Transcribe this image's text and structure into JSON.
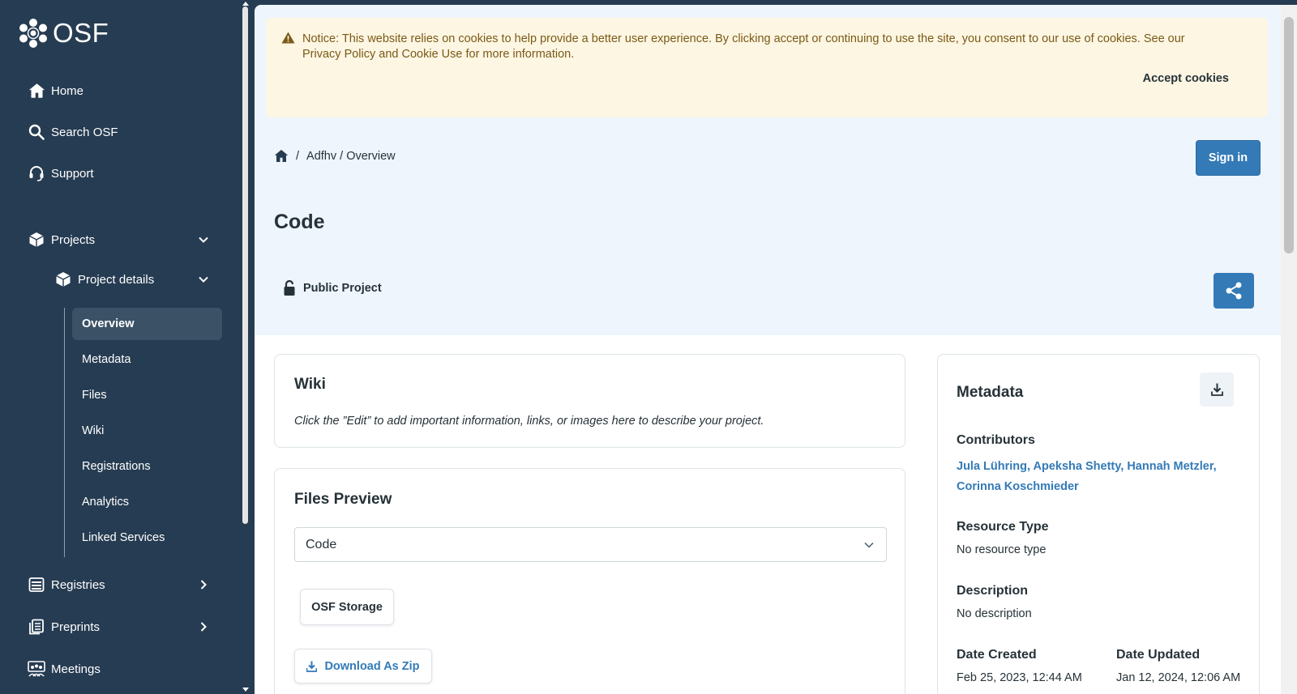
{
  "app": {
    "logo_text": "OSF"
  },
  "sidebar": {
    "items": [
      {
        "label": "Home",
        "icon": "home-icon"
      },
      {
        "label": "Search OSF",
        "icon": "search-icon"
      },
      {
        "label": "Support",
        "icon": "headset-icon"
      }
    ],
    "projects": {
      "label": "Projects",
      "icon": "cube-icon"
    },
    "project_details": {
      "label": "Project details",
      "icon": "cube-icon"
    },
    "subitems": [
      "Overview",
      "Metadata",
      "Files",
      "Wiki",
      "Registrations",
      "Analytics",
      "Linked Services"
    ],
    "active_subitem": "Overview",
    "registries": {
      "label": "Registries",
      "icon": "registries-icon"
    },
    "preprints": {
      "label": "Preprints",
      "icon": "preprints-icon"
    },
    "meetings": {
      "label": "Meetings",
      "icon": "meetings-icon"
    }
  },
  "cookie_banner": {
    "message": "Notice: This website relies on cookies to help provide a better user experience. By clicking accept or continuing to use the site, you consent to our use of cookies. See our Privacy Policy and Cookie Use for more information.",
    "accept_label": "Accept cookies"
  },
  "breadcrumb": {
    "separator": "/",
    "path": "Adfhv / Overview"
  },
  "header": {
    "signin_label": "Sign in",
    "title": "Code",
    "visibility": "Public Project"
  },
  "wiki": {
    "title": "Wiki",
    "description": "Click the ”Edit” to add important information, links, or images here to describe your project."
  },
  "files_preview": {
    "title": "Files Preview",
    "selected": "Code",
    "storage_label": "OSF Storage",
    "download_label": "Download As Zip"
  },
  "metadata": {
    "title": "Metadata",
    "contributors_label": "Contributors",
    "contributors": [
      "Jula Lühring,",
      "Apeksha Shetty,",
      "Hannah Metzler,",
      "Corinna Koschmieder"
    ],
    "resource_type_label": "Resource Type",
    "resource_type": "No resource type",
    "description_label": "Description",
    "description": "No description",
    "date_created_label": "Date Created",
    "date_created": "Feb 25, 2023, 12:44 AM",
    "date_updated_label": "Date Updated",
    "date_updated": "Jan 12, 2024, 12:06 AM"
  },
  "colors": {
    "sidebar_bg": "#263c52",
    "accent": "#337ab7",
    "hero_bg": "#eef5fc",
    "cookie_bg": "#fdf6e3"
  }
}
